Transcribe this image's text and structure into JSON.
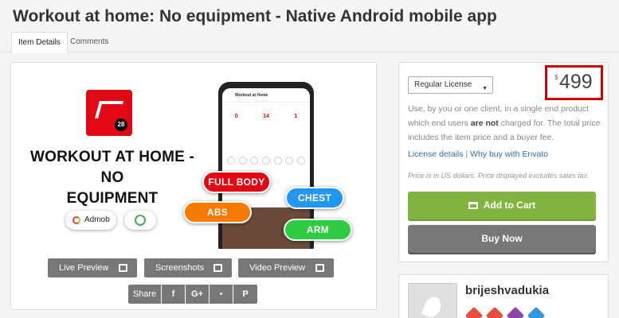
{
  "header": {
    "title": "Workout at home: No equipment - Native Android mobile app",
    "tabs": [
      {
        "label": "Item Details",
        "active": true
      },
      {
        "label": "Comments",
        "active": false
      }
    ]
  },
  "banner": {
    "title_line1": "WORKOUT AT HOME - NO",
    "title_line2": "EQUIPMENT",
    "logo_badge": "28",
    "admob_label": "Admob",
    "phone": {
      "app_title": "Workout at Home",
      "stats": [
        "0",
        "14",
        "1"
      ]
    },
    "tags": {
      "full_body": "FULL BODY",
      "chest": "CHEST",
      "abs": "ABS",
      "arm": "ARM"
    },
    "colors": {
      "red": "#e30613",
      "blue": "#2196f3",
      "orange": "#f57c00",
      "green": "#2ecc40"
    }
  },
  "preview_buttons": {
    "live_preview": "Live Preview",
    "screenshots": "Screenshots",
    "video_preview": "Video Preview"
  },
  "share": {
    "label": "Share",
    "facebook": "f",
    "google_plus": "G+",
    "twitter": "•",
    "pinterest": "P"
  },
  "purchase": {
    "license_select": "Regular License",
    "currency_symbol": "$",
    "price": "499",
    "desc_part1": "Use, by you or one client, in a single end product which end users ",
    "desc_bold": "are not",
    "desc_part2": " charged for. The total price includes the item price and a buyer fee.",
    "license_details": "License details",
    "separator": "|",
    "why_envato": "Why buy with Envato",
    "note": "Price is in US dollars. Price displayed excludes sales tax.",
    "add_to_cart": "Add to Cart",
    "buy_now": "Buy Now",
    "colors": {
      "add_to_cart": "#82b440",
      "buy_now": "#777777",
      "price_highlight": "#cc0000"
    }
  },
  "author": {
    "name": "brijeshvadukia",
    "badge_colors": [
      "#e74c3c",
      "#e74c3c",
      "#8e44ad",
      "#3498db"
    ]
  }
}
